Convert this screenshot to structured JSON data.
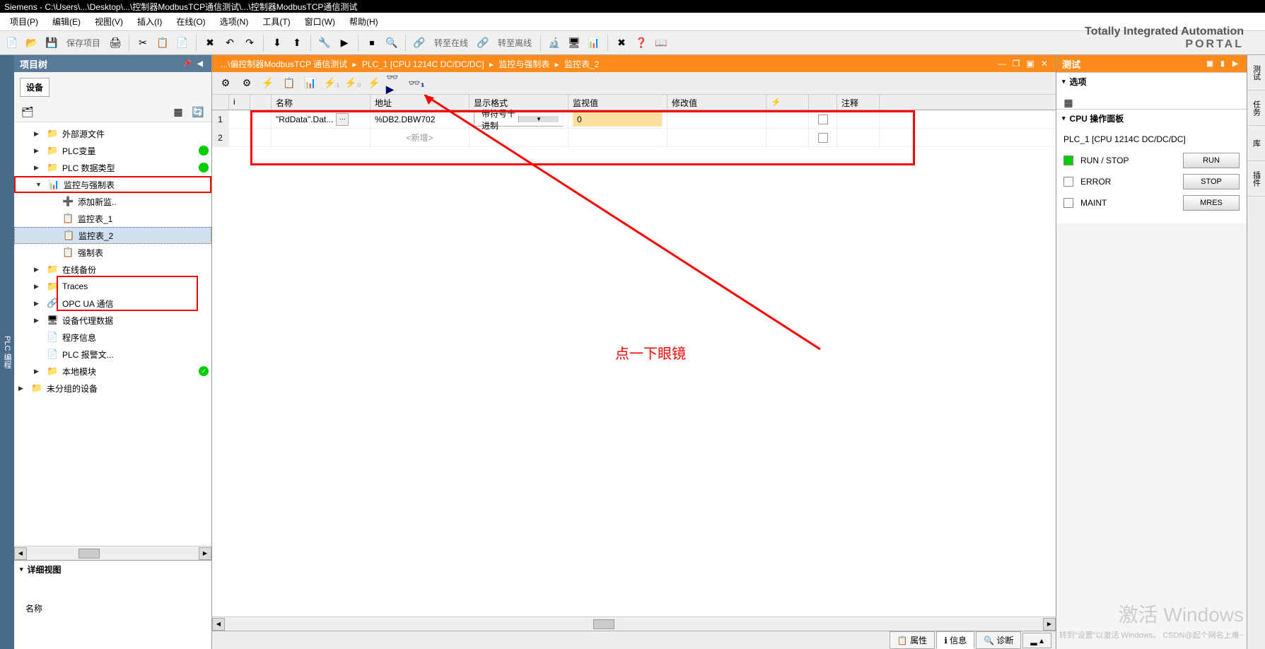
{
  "titlebar": "Siemens - C:\\Users\\...\\Desktop\\...\\控制器ModbusTCP通信测试\\...\\控制器ModbusTCP通信测试",
  "menus": [
    "项目(P)",
    "编辑(E)",
    "视图(V)",
    "插入(I)",
    "在线(O)",
    "选项(N)",
    "工具(T)",
    "窗口(W)",
    "帮助(H)"
  ],
  "brand": {
    "line1": "Totally Integrated Automation",
    "line2": "PORTAL"
  },
  "toolbar_text": {
    "save": "保存项目",
    "goonline": "转至在线",
    "gooffline": "转至离线"
  },
  "tree": {
    "header": "项目树",
    "tab": "设备",
    "items": [
      {
        "indent": 1,
        "arrow": "▶",
        "icon": "📁",
        "label": "外部源文件",
        "dot": ""
      },
      {
        "indent": 1,
        "arrow": "▶",
        "icon": "📁",
        "label": "PLC变量",
        "dot": "green"
      },
      {
        "indent": 1,
        "arrow": "▶",
        "icon": "📁",
        "label": "PLC 数据类型",
        "dot": "green"
      },
      {
        "indent": 1,
        "arrow": "▼",
        "icon": "📊",
        "label": "监控与强制表",
        "dot": "",
        "red": true
      },
      {
        "indent": 2,
        "arrow": "",
        "icon": "➕",
        "label": "添加新监..",
        "dot": ""
      },
      {
        "indent": 2,
        "arrow": "",
        "icon": "📋",
        "label": "监控表_1",
        "dot": ""
      },
      {
        "indent": 2,
        "arrow": "",
        "icon": "📋",
        "label": "监控表_2",
        "dot": "",
        "selected": true
      },
      {
        "indent": 2,
        "arrow": "",
        "icon": "📋",
        "label": "强制表",
        "dot": ""
      },
      {
        "indent": 1,
        "arrow": "▶",
        "icon": "📁",
        "label": "在线备份",
        "dot": ""
      },
      {
        "indent": 1,
        "arrow": "▶",
        "icon": "📁",
        "label": "Traces",
        "dot": ""
      },
      {
        "indent": 1,
        "arrow": "▶",
        "icon": "🔗",
        "label": "OPC UA 通信",
        "dot": ""
      },
      {
        "indent": 1,
        "arrow": "▶",
        "icon": "🖥",
        "label": "设备代理数据",
        "dot": ""
      },
      {
        "indent": 1,
        "arrow": "",
        "icon": "📄",
        "label": "程序信息",
        "dot": ""
      },
      {
        "indent": 1,
        "arrow": "",
        "icon": "📄",
        "label": "PLC 报警文...",
        "dot": ""
      },
      {
        "indent": 1,
        "arrow": "▶",
        "icon": "📁",
        "label": "本地模块",
        "dot": "check"
      },
      {
        "indent": 0,
        "arrow": "▶",
        "icon": "📁",
        "label": "未分组的设备",
        "dot": ""
      }
    ],
    "detail_header": "详细视图",
    "detail_col": "名称"
  },
  "breadcrumb": {
    "parts": [
      "...\\偏控制器ModbusTCP 通信测试",
      "PLC_1 [CPU 1214C DC/DC/DC]",
      "监控与强制表",
      "监控表_2"
    ]
  },
  "watch_cols": [
    "i",
    "",
    "名称",
    "地址",
    "显示格式",
    "监视值",
    "修改值",
    "",
    "",
    "注释"
  ],
  "watch_rows": [
    {
      "idx": "1",
      "name": "\"RdData\".Dat...",
      "addr": "%DB2.DBW702",
      "fmt": "带符号十进制",
      "mon": "0",
      "mod": ""
    },
    {
      "idx": "2",
      "name": "",
      "addr": "<新增>",
      "fmt": "",
      "mon": "",
      "mod": "",
      "addnew": true
    }
  ],
  "annotation": "点一下眼镜",
  "bottom_tabs": [
    "属性",
    "信息",
    "诊断"
  ],
  "right": {
    "header": "测试",
    "options": "选项",
    "cpu_header": "CPU 操作面板",
    "cpu_title": "PLC_1 [CPU 1214C DC/DC/DC]",
    "rows": [
      {
        "led": "green",
        "label": "RUN / STOP",
        "btn": "RUN"
      },
      {
        "led": "",
        "label": "ERROR",
        "btn": "STOP"
      },
      {
        "led": "",
        "label": "MAINT",
        "btn": "MRES"
      }
    ]
  },
  "right_tabs": [
    "测试",
    "任务",
    "库",
    "插件"
  ],
  "watermark": "激活 Windows",
  "watermark_sub": "转到\"设置\"以激活 Windows。 CSDN@起个网名上难~",
  "sidebar_tab": "PLC 编程"
}
